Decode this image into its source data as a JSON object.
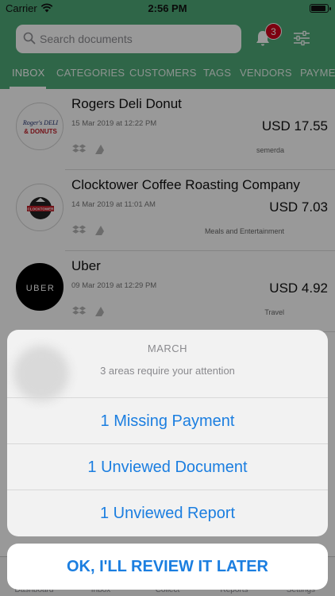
{
  "status_bar": {
    "carrier": "Carrier",
    "time": "2:56 PM"
  },
  "header": {
    "search_placeholder": "Search documents",
    "notification_count": "3",
    "tabs": [
      "INBOX",
      "CATEGORIES",
      "CUSTOMERS",
      "TAGS",
      "VENDORS",
      "PAYMEN"
    ]
  },
  "documents": [
    {
      "vendor": "Rogers Deli Donut",
      "date": "15 Mar 2019 at 12:22 PM",
      "amount": "USD 17.55",
      "category": "semerda",
      "logo_text": [
        "Roger's DELI",
        "& DONUTS"
      ]
    },
    {
      "vendor": "Clocktower Coffee Roasting Company",
      "date": "14 Mar 2019 at 11:01 AM",
      "amount": "USD 7.03",
      "category": "Meals and Entertainment",
      "logo_text": [
        "CLOCKTOWER"
      ]
    },
    {
      "vendor": "Uber",
      "date": "09 Mar 2019 at 12:29 PM",
      "amount": "USD 4.92",
      "category": "Travel",
      "logo_text": [
        "UBER"
      ]
    }
  ],
  "tab_bar": [
    "Dashboard",
    "Inbox",
    "Collect",
    "Reports",
    "Settings"
  ],
  "action_sheet": {
    "title": "MARCH",
    "message": "3 areas require your attention",
    "actions": [
      "1 Missing Payment",
      "1 Unviewed Document",
      "1 Unviewed Report"
    ],
    "cancel": "OK, I'LL REVIEW IT LATER"
  },
  "colors": {
    "brand_green": "#4fab79",
    "action_blue": "#1b7ee0",
    "badge_red": "#d0021b"
  }
}
